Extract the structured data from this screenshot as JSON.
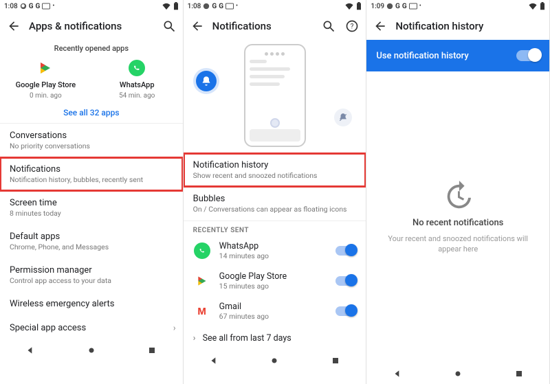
{
  "pane1": {
    "clock": "1:08",
    "title": "Apps & notifications",
    "recently_label": "Recently opened apps",
    "apps": [
      {
        "name": "Google Play Store",
        "sub": "0 min. ago",
        "icon": "play-store-icon"
      },
      {
        "name": "WhatsApp",
        "sub": "54 min. ago",
        "icon": "whatsapp-icon"
      }
    ],
    "see_all": "See all 32 apps",
    "rows": [
      {
        "t": "Conversations",
        "s": "No priority conversations",
        "hl": false
      },
      {
        "t": "Notifications",
        "s": "Notification history, bubbles, recently sent",
        "hl": true
      },
      {
        "t": "Screen time",
        "s": "8 minutes today",
        "hl": false
      },
      {
        "t": "Default apps",
        "s": "Chrome, Phone, and Messages",
        "hl": false
      },
      {
        "t": "Permission manager",
        "s": "Control app access to your data",
        "hl": false
      },
      {
        "t": "Wireless emergency alerts",
        "s": "",
        "hl": false
      },
      {
        "t": "Special app access",
        "s": "",
        "hl": false,
        "arrow": true
      }
    ]
  },
  "pane2": {
    "clock": "1:08",
    "title": "Notifications",
    "rows_top": [
      {
        "t": "Notification history",
        "s": "Show recent and snoozed notifications",
        "hl": true
      },
      {
        "t": "Bubbles",
        "s": "On / Conversations can appear as floating icons",
        "hl": false
      }
    ],
    "section": "RECENTLY SENT",
    "recent": [
      {
        "n": "WhatsApp",
        "m": "14 minutes ago",
        "icon": "whatsapp-icon"
      },
      {
        "n": "Google Play Store",
        "m": "15 minutes ago",
        "icon": "play-store-icon"
      },
      {
        "n": "Gmail",
        "m": "67 minutes ago",
        "icon": "gmail-icon"
      }
    ],
    "see_all": "See all from last 7 days"
  },
  "pane3": {
    "clock": "1:09",
    "title": "Notification history",
    "toggle_label": "Use notification history",
    "empty_title": "No recent notifications",
    "empty_sub": "Your recent and snoozed notifications will appear here"
  }
}
